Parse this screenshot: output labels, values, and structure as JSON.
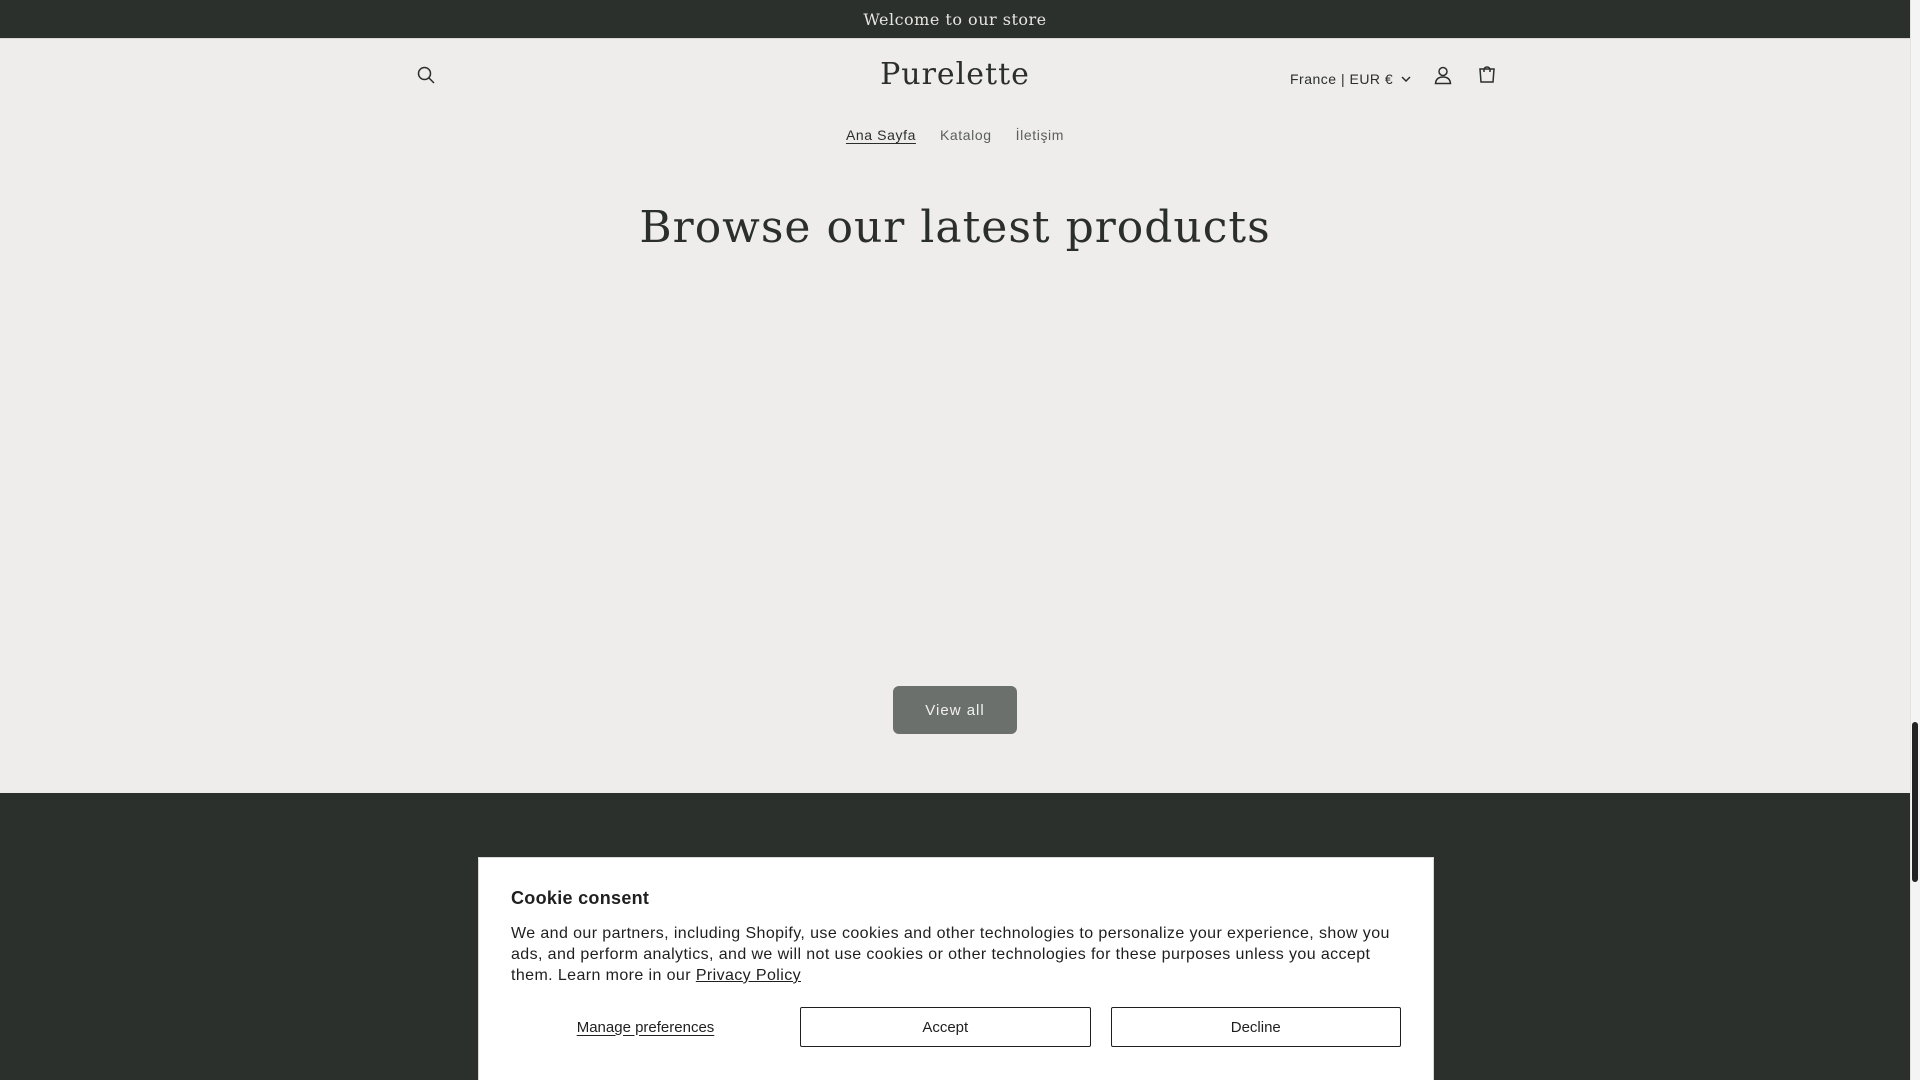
{
  "announcement": {
    "text": "Welcome to our store"
  },
  "header": {
    "logo": "Purelette",
    "country_selector": "France | EUR €",
    "icons": {
      "search": "search-icon",
      "account": "account-icon",
      "cart": "cart-icon",
      "chevron": "chevron-down-icon"
    }
  },
  "nav": {
    "items": [
      {
        "label": "Ana Sayfa",
        "active": true
      },
      {
        "label": "Katalog",
        "active": false
      },
      {
        "label": "İletişim",
        "active": false
      }
    ]
  },
  "main": {
    "section_title": "Browse our latest products",
    "view_all_label": "View all"
  },
  "cookie": {
    "title": "Cookie consent",
    "text": "We and our partners, including Shopify, use cookies and other technologies to personalize your experience, show you ads, and perform analytics, and we will not use cookies or other technologies for these purposes unless you accept them. Learn more in our",
    "privacy_link": "Privacy Policy",
    "manage_label": "Manage preferences",
    "accept_label": "Accept",
    "decline_label": "Decline"
  },
  "colors": {
    "background": "#efedeb",
    "dark": "#2b302c",
    "button": "#6b706c",
    "white": "#ffffff"
  }
}
